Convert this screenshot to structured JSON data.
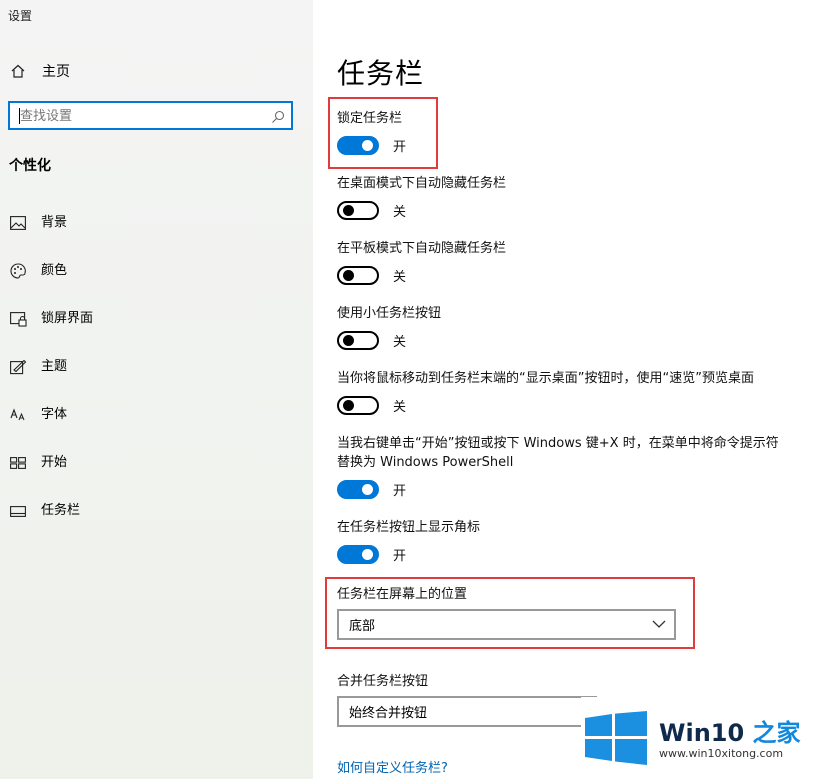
{
  "window": {
    "title": "设置"
  },
  "sidebar": {
    "home_label": "主页",
    "search_placeholder": "查找设置",
    "section_title": "个性化",
    "items": [
      {
        "label": "背景",
        "icon": "picture-icon"
      },
      {
        "label": "颜色",
        "icon": "palette-icon"
      },
      {
        "label": "锁屏界面",
        "icon": "lock-screen-icon"
      },
      {
        "label": "主题",
        "icon": "theme-icon"
      },
      {
        "label": "字体",
        "icon": "font-icon"
      },
      {
        "label": "开始",
        "icon": "start-icon"
      },
      {
        "label": "任务栏",
        "icon": "taskbar-icon"
      }
    ]
  },
  "main": {
    "title": "任务栏",
    "settings": [
      {
        "label": "锁定任务栏",
        "state": "开",
        "on": true
      },
      {
        "label": "在桌面模式下自动隐藏任务栏",
        "state": "关",
        "on": false
      },
      {
        "label": "在平板模式下自动隐藏任务栏",
        "state": "关",
        "on": false
      },
      {
        "label": "使用小任务栏按钮",
        "state": "关",
        "on": false
      },
      {
        "label": "当你将鼠标移动到任务栏末端的“显示桌面”按钮时，使用“速览”预览桌面",
        "state": "关",
        "on": false
      },
      {
        "label": "当我右键单击“开始”按钮或按下 Windows 键+X 时，在菜单中将命令提示符替换为 Windows PowerShell",
        "state": "开",
        "on": true
      },
      {
        "label": "在任务栏按钮上显示角标",
        "state": "开",
        "on": true
      }
    ],
    "position": {
      "label": "任务栏在屏幕上的位置",
      "value": "底部"
    },
    "combine": {
      "label": "合并任务栏按钮",
      "value": "始终合并按钮"
    },
    "help_link": "如何自定义任务栏?"
  },
  "watermark": {
    "brand_a": "Win10",
    "brand_b": " 之家",
    "url": "www.win10xitong.com"
  },
  "colors": {
    "accent": "#0078d7",
    "highlight": "#e23b3b",
    "link": "#0063b1"
  }
}
